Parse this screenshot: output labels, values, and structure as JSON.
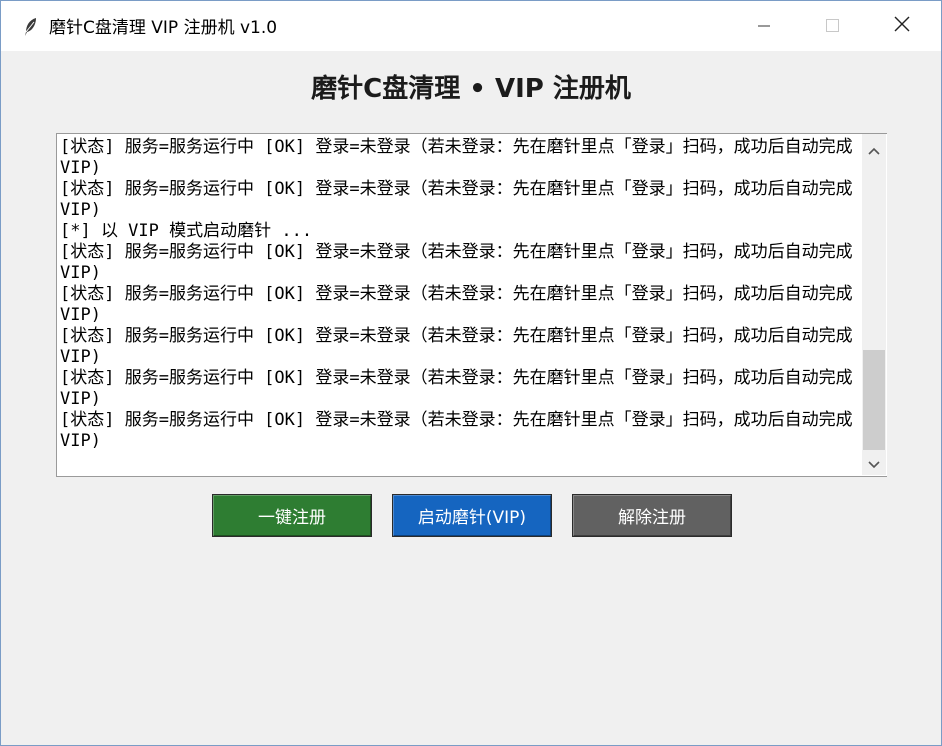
{
  "window": {
    "title": "磨针C盘清理 VIP 注册机 v1.0",
    "icon": "feather-icon"
  },
  "controls": {
    "minimize_icon": "minimize-icon",
    "maximize_icon": "maximize-icon",
    "close_icon": "close-icon"
  },
  "header": {
    "title": "磨针C盘清理 • VIP 注册机"
  },
  "log": {
    "lines": [
      "[状态] 服务=服务运行中 [OK] 登录=未登录（若未登录：先在磨针里点「登录」扫码，成功后自动完成 VIP)",
      "[状态] 服务=服务运行中 [OK] 登录=未登录（若未登录：先在磨针里点「登录」扫码，成功后自动完成 VIP)",
      "[*] 以 VIP 模式启动磨针 ...",
      "[状态] 服务=服务运行中 [OK] 登录=未登录（若未登录：先在磨针里点「登录」扫码，成功后自动完成 VIP)",
      "[状态] 服务=服务运行中 [OK] 登录=未登录（若未登录：先在磨针里点「登录」扫码，成功后自动完成 VIP)",
      "[状态] 服务=服务运行中 [OK] 登录=未登录（若未登录：先在磨针里点「登录」扫码，成功后自动完成 VIP)",
      "[状态] 服务=服务运行中 [OK] 登录=未登录（若未登录：先在磨针里点「登录」扫码，成功后自动完成 VIP)",
      "[状态] 服务=服务运行中 [OK] 登录=未登录（若未登录：先在磨针里点「登录」扫码，成功后自动完成 VIP)"
    ]
  },
  "buttons": {
    "register": {
      "label": "一键注册",
      "color": "#2e7d32"
    },
    "launch": {
      "label": "启动磨针(VIP)",
      "color": "#1565c0"
    },
    "unregister": {
      "label": "解除注册",
      "color": "#616161"
    }
  }
}
